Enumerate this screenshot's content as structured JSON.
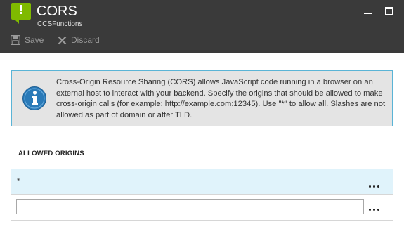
{
  "header": {
    "title": "CORS",
    "subtitle": "CCSFunctions",
    "app_icon_glyph": "!",
    "app_icon_color": "#7fba00",
    "background_color": "#3a3a3a"
  },
  "window_controls": {
    "minimize_icon": "minimize-icon",
    "maximize_icon": "maximize-icon"
  },
  "toolbar": {
    "save_label": "Save",
    "save_icon": "save-icon",
    "discard_label": "Discard",
    "discard_icon": "close-icon",
    "disabled_color": "#9a9a9a"
  },
  "info": {
    "icon": "info-icon",
    "icon_color": "#2a7ab8",
    "border_color": "#5ab4d6",
    "text": "Cross-Origin Resource Sharing (CORS) allows JavaScript code running in a browser on an external host to interact with your backend. Specify the origins that should be allowed to make cross-origin calls (for example: http://example.com:12345). Use \"*\" to allow all. Slashes are not allowed as part of domain or after TLD."
  },
  "allowed_origins": {
    "label": "ALLOWED ORIGINS",
    "origins": [
      "*"
    ],
    "new_origin_value": "",
    "new_origin_placeholder": "",
    "row_highlight_color": "#e0f3fb",
    "more_icon": "more-icon"
  }
}
